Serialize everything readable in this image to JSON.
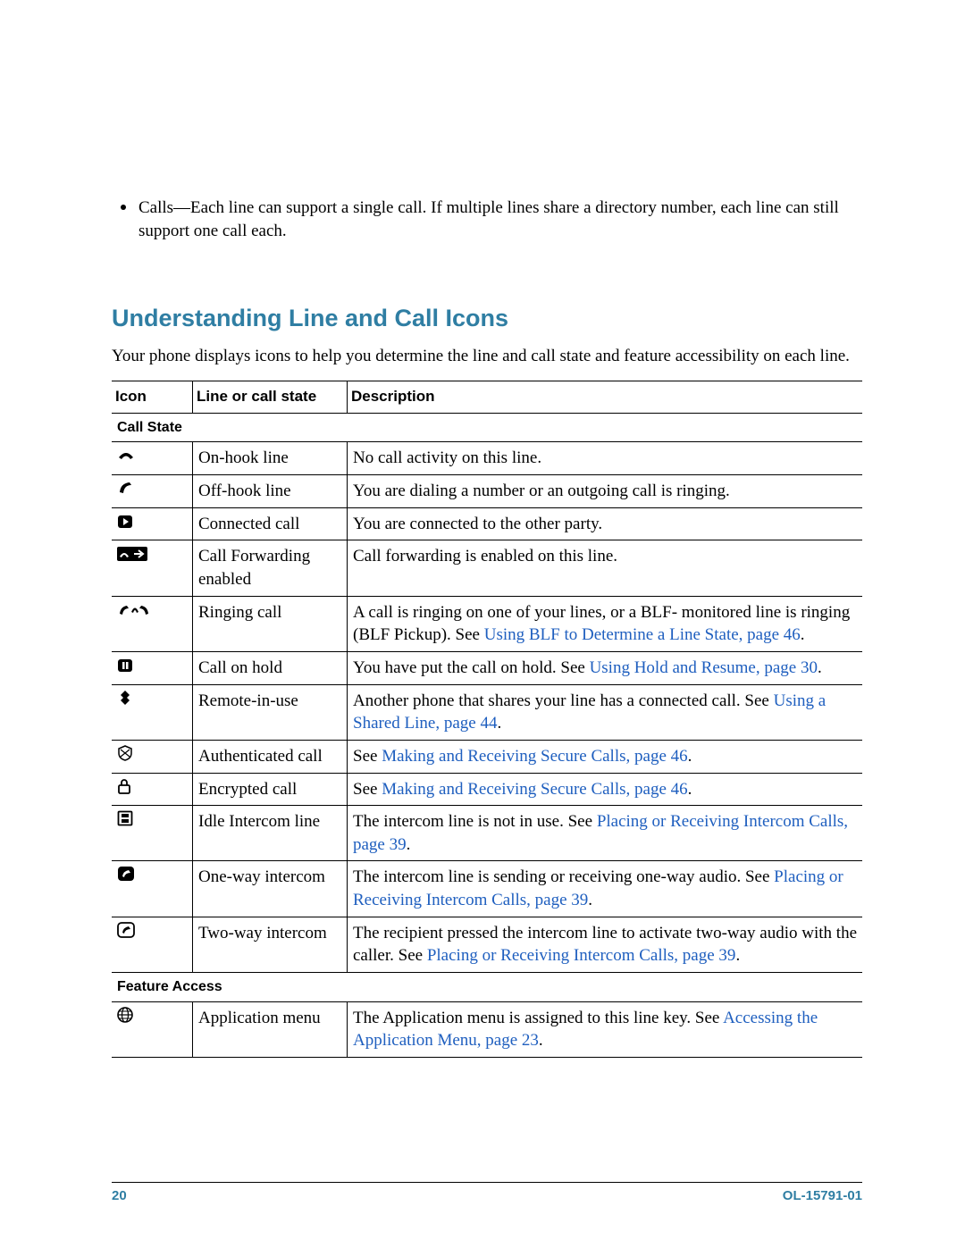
{
  "bullet": "Calls—Each line can support a single call. If multiple lines share a directory number, each line can still support one call each.",
  "heading": "Understanding Line and Call Icons",
  "intro": "Your phone displays icons to help you determine the line and call state and feature accessibility on each line.",
  "columns": {
    "c1": "Icon",
    "c2": "Line or call state",
    "c3": "Description"
  },
  "sections": {
    "callState": "Call State",
    "featureAccess": "Feature Access"
  },
  "rows": {
    "r1": {
      "state": "On-hook line",
      "desc": "No call activity on this line."
    },
    "r2": {
      "state": "Off-hook line",
      "desc": "You are dialing a number or an outgoing call is ringing."
    },
    "r3": {
      "state": "Connected call",
      "desc": "You are connected to the other party."
    },
    "r4": {
      "state": "Call Forwarding enabled",
      "desc": "Call forwarding is enabled on this line."
    },
    "r5": {
      "state": "Ringing call",
      "descA": "A call is ringing on one of your lines, or a BLF- monitored line is ringing (BLF Pickup). See ",
      "link": "Using BLF to Determine a Line State, page 46",
      "descB": "."
    },
    "r6": {
      "state": "Call on hold",
      "descA": "You have put the call on hold. See ",
      "link": "Using Hold and Resume, page 30",
      "descB": "."
    },
    "r7": {
      "state": "Remote-in-use",
      "descA": "Another phone that shares your line has a connected call. See ",
      "link": "Using a Shared Line, page 44",
      "descB": "."
    },
    "r8": {
      "state": "Authenticated call",
      "descA": "See ",
      "link": "Making and Receiving Secure Calls, page 46",
      "descB": "."
    },
    "r9": {
      "state": "Encrypted call",
      "descA": "See ",
      "link": "Making and Receiving Secure Calls, page 46",
      "descB": "."
    },
    "r10": {
      "state": "Idle Intercom line",
      "descA": "The intercom line is not in use. See ",
      "link": "Placing or Receiving Intercom Calls, page 39",
      "descB": "."
    },
    "r11": {
      "state": "One-way intercom",
      "descA": "The intercom line is sending or receiving one-way audio. See ",
      "link": "Placing or Receiving Intercom Calls, page 39",
      "descB": "."
    },
    "r12": {
      "state": "Two-way intercom",
      "descA": "The recipient pressed the intercom line to activate two-way audio with the caller. See ",
      "link": "Placing or Receiving Intercom Calls, page 39",
      "descB": "."
    },
    "r13": {
      "state": "Application menu",
      "descA": "The Application menu is assigned to this line key. See ",
      "link": "Accessing the Application Menu, page 23",
      "descB": "."
    }
  },
  "footer": {
    "page": "20",
    "doc": "OL-15791-01"
  }
}
